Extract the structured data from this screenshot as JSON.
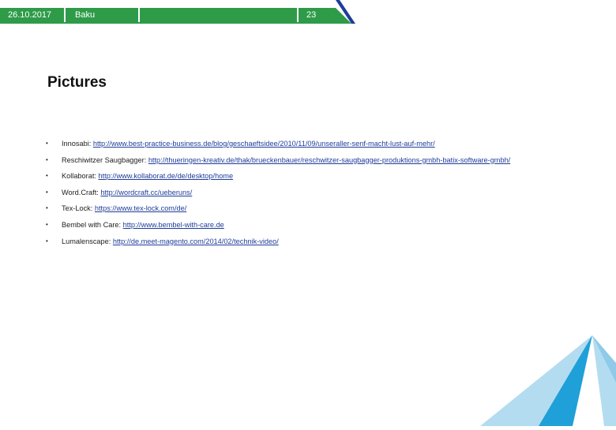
{
  "header": {
    "date": "26.10.2017",
    "location": "Baku",
    "page_number": "23",
    "colors": {
      "primary_green": "#2e9b49",
      "accent_blue": "#1f3d99",
      "triangle_left": "#1fa0d8",
      "triangle_right": "#b4dcf0"
    }
  },
  "page_title": "Pictures",
  "items": [
    {
      "label": "Innosabi: ",
      "url": "http://www.best-practice-business.de/blog/geschaeftsidee/2010/11/09/unseraller-senf-macht-lust-auf-mehr/"
    },
    {
      "label": "Reschiwitzer Saugbagger: ",
      "url": "http://thueringen-kreativ.de/thak/brueckenbauer/reschwitzer-saugbagger-produktions-gmbh-batix-software-gmbh/"
    },
    {
      "label": "Kollaborat: ",
      "url": "http://www.kollaborat.de/de/desktop/home"
    },
    {
      "label": "Word.Craft: ",
      "url": "http://wordcraft.cc/ueberuns/"
    },
    {
      "label": "Tex-Lock: ",
      "url": "https://www.tex-lock.com/de/"
    },
    {
      "label": "Bembel with Care: ",
      "url": "http://www.bembel-with-care.de"
    },
    {
      "label": "Lumalenscape: ",
      "url": "http://de.meet-magento.com/2014/02/technik-video/"
    }
  ],
  "bullet_char": "•"
}
